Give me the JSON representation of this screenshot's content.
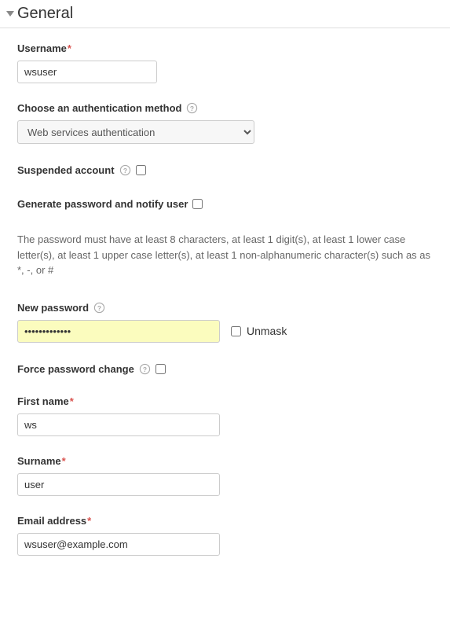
{
  "section": {
    "title": "General"
  },
  "fields": {
    "username": {
      "label": "Username",
      "value": "wsuser"
    },
    "auth_method": {
      "label": "Choose an authentication method",
      "value": "Web services authentication"
    },
    "suspended": {
      "label": "Suspended account"
    },
    "generate_pw": {
      "label": "Generate password and notify user"
    },
    "pw_help": "The password must have at least 8 characters, at least 1 digit(s), at least 1 lower case letter(s), at least 1 upper case letter(s), at least 1 non-alphanumeric character(s) such as as *, -, or #",
    "new_password": {
      "label": "New password",
      "value": "•••••••••••••"
    },
    "unmask": {
      "label": "Unmask"
    },
    "force_change": {
      "label": "Force password change"
    },
    "firstname": {
      "label": "First name",
      "value": "ws"
    },
    "surname": {
      "label": "Surname",
      "value": "user"
    },
    "email": {
      "label": "Email address",
      "value": "wsuser@example.com"
    }
  }
}
